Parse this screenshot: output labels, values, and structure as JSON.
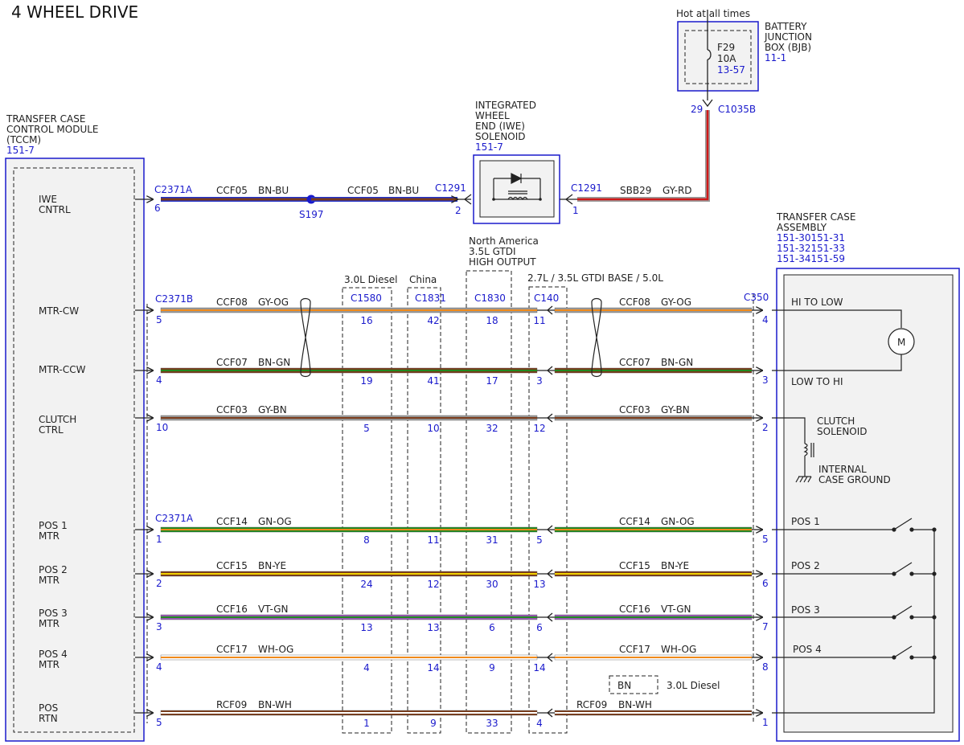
{
  "title": "4 WHEEL DRIVE",
  "colors": {
    "link_blue": "#1a1acc",
    "module_fill": "#f2f2f2",
    "BN": "#7a3b1a",
    "BU": "#2233cc",
    "GY": "#9a9a9a",
    "RD": "#d01818",
    "OG": "#f08a1a",
    "GN": "#1f8a1f",
    "YE": "#f2d200",
    "VT": "#9b59b6",
    "WH": "#ffffff"
  },
  "battery_box": {
    "hot_text": "Hot at all times",
    "name_lines": [
      "BATTERY",
      "JUNCTION",
      "BOX (BJB)"
    ],
    "ref": "11-1",
    "fuse_name": "F29",
    "fuse_rating": "10A",
    "fuse_ref": "13-57",
    "pin": "29",
    "connector": "C1035B"
  },
  "tccm": {
    "name_lines": [
      "TRANSFER CASE",
      "CONTROL MODULE",
      "(TCCM)"
    ],
    "ref": "151-7",
    "pins": [
      {
        "lines": [
          "IWE",
          "CNTRL"
        ]
      },
      {
        "lines": [
          "MTR-CW"
        ]
      },
      {
        "lines": [
          "MTR-CCW"
        ]
      },
      {
        "lines": [
          "CLUTCH",
          "CTRL"
        ]
      },
      {
        "lines": [
          "POS 1",
          "MTR"
        ]
      },
      {
        "lines": [
          "POS 2",
          "MTR"
        ]
      },
      {
        "lines": [
          "POS 3",
          "MTR"
        ]
      },
      {
        "lines": [
          "POS 4",
          "MTR"
        ]
      },
      {
        "lines": [
          "POS",
          "RTN"
        ]
      }
    ]
  },
  "iwe": {
    "name_lines": [
      "INTEGRATED",
      "WHEEL",
      "END (IWE)",
      "SOLENOID"
    ],
    "ref": "151-7",
    "connector_left": "C1291",
    "pin_left": "2",
    "connector_right": "C1291",
    "pin_right": "1"
  },
  "transfer_case": {
    "name_lines": [
      "TRANSFER CASE",
      "ASSEMBLY"
    ],
    "refs": [
      "151-30151-31",
      "151-32151-33",
      "151-34151-59"
    ],
    "connector": "C350",
    "hi_to_low": "HI TO LOW",
    "low_to_hi": "LOW TO HI",
    "motor": "M",
    "clutch_lines": [
      "CLUTCH",
      "SOLENOID"
    ],
    "ground_lines": [
      "INTERNAL",
      "CASE GROUND"
    ],
    "pos_labels": [
      "POS 1",
      "POS 2",
      "POS 3",
      "POS 4"
    ]
  },
  "splice": "S197",
  "variants": [
    {
      "label_lines": [
        "3.0L Diesel"
      ],
      "connector": "C1580"
    },
    {
      "label_lines": [
        "China"
      ],
      "connector": "C1831"
    },
    {
      "label_lines": [
        "North America",
        "3.5L GTDI",
        "HIGH OUTPUT"
      ],
      "connector": "C1830"
    },
    {
      "label_lines": [
        "2.7L / 3.5L GTDI BASE / 5.0L"
      ],
      "connector": "C140"
    }
  ],
  "legend": {
    "code": "BN",
    "text": "3.0L Diesel"
  },
  "iwe_row": {
    "tccm_connector": "C2371A",
    "tccm_pin": "6",
    "seg1": {
      "circuit": "CCF05",
      "color": "BN-BU"
    },
    "seg2": {
      "circuit": "CCF05",
      "color": "BN-BU"
    },
    "seg3": {
      "circuit": "SBB29",
      "color": "GY-RD"
    }
  },
  "rows": [
    {
      "tccm_connector": "C2371B",
      "tccm_pin": "5",
      "circuit": "CCF08",
      "color": "GY-OG",
      "v": [
        "16",
        "42",
        "18",
        "11"
      ],
      "c350_pin": "4"
    },
    {
      "tccm_connector": "",
      "tccm_pin": "4",
      "circuit": "CCF07",
      "color": "BN-GN",
      "v": [
        "19",
        "41",
        "17",
        "3"
      ],
      "c350_pin": "3"
    },
    {
      "tccm_connector": "",
      "tccm_pin": "10",
      "circuit": "CCF03",
      "color": "GY-BN",
      "v": [
        "5",
        "10",
        "32",
        "12"
      ],
      "c350_pin": "2"
    },
    {
      "tccm_connector": "C2371A",
      "tccm_pin": "1",
      "circuit": "CCF14",
      "color": "GN-OG",
      "v": [
        "8",
        "11",
        "31",
        "5"
      ],
      "c350_pin": "5"
    },
    {
      "tccm_connector": "",
      "tccm_pin": "2",
      "circuit": "CCF15",
      "color": "BN-YE",
      "v": [
        "24",
        "12",
        "30",
        "13"
      ],
      "c350_pin": "6"
    },
    {
      "tccm_connector": "",
      "tccm_pin": "3",
      "circuit": "CCF16",
      "color": "VT-GN",
      "v": [
        "13",
        "13",
        "6",
        "6"
      ],
      "c350_pin": "7"
    },
    {
      "tccm_connector": "",
      "tccm_pin": "4",
      "circuit": "CCF17",
      "color": "WH-OG",
      "v": [
        "4",
        "14",
        "9",
        "14"
      ],
      "c350_pin": "8"
    },
    {
      "tccm_connector": "",
      "tccm_pin": "5",
      "circuit": "RCF09",
      "color": "BN-WH",
      "v": [
        "1",
        "9",
        "33",
        "4"
      ],
      "c350_pin": "1"
    }
  ]
}
